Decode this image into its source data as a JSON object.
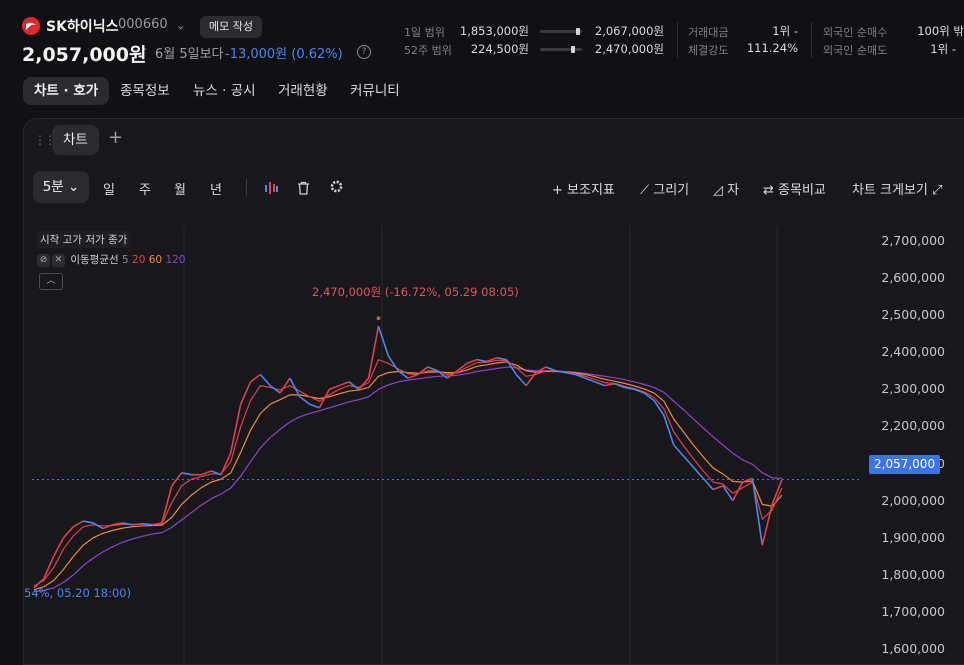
{
  "header": {
    "name": "SK하이닉스",
    "code": "000660",
    "memo_label": "메모 작성",
    "price": "2,057,000원",
    "since": "6월 5일보다",
    "change": "-13,000원 (0.62%)",
    "help": "?"
  },
  "ranges": {
    "day_label": "1일 범위",
    "day_low": "1,853,000원",
    "day_high": "2,067,000원",
    "day_position": 0.95,
    "week52_label": "52주 범위",
    "week52_low": "224,500원",
    "week52_high": "2,470,000원",
    "week52_position": 0.81
  },
  "stats": {
    "volume_rank_label": "거래대금",
    "volume_rank": "1위 -",
    "strength_label": "체결강도",
    "strength": "111.24%",
    "foreign_buy_label": "외국인 순매수",
    "foreign_buy": "100위 밖",
    "foreign_sell_label": "외국인 순매도",
    "foreign_sell": "1위 -"
  },
  "tabs": [
    "차트 · 호가",
    "종목정보",
    "뉴스 · 공시",
    "거래현황",
    "커뮤니티"
  ],
  "chart_panel": {
    "tab_label": "차트",
    "add": "+",
    "period": "5분",
    "ranges": [
      "일",
      "주",
      "월",
      "년"
    ],
    "tools": {
      "indicator": "보조지표",
      "draw": "그리기",
      "ruler": "자",
      "compare": "종목비교",
      "fullscreen": "차트 크게보기"
    },
    "legend": "시작 고가 저가 종가",
    "ma_label": "이동평균선",
    "ma_periods": [
      {
        "label": "5",
        "color": "#8a8a92"
      },
      {
        "label": "20",
        "color": "#e0404a"
      },
      {
        "label": "60",
        "color": "#f08a3a"
      },
      {
        "label": "120",
        "color": "#8e44c8"
      }
    ],
    "current_price_tag": "2,057,000",
    "high_annotation": "2,470,000원 (-16.72%, 05.29 08:05)",
    "low_annotation": "54%, 05.20 18:00)"
  },
  "chart_data": {
    "type": "line",
    "yticks": [
      "2,700,000",
      "2,600,000",
      "2,500,000",
      "2,400,000",
      "2,300,000",
      "2,200,000",
      "2,100,000",
      "2,000,000",
      "1,900,000",
      "1,800,000",
      "1,700,000",
      "1,600,000"
    ],
    "ylim": [
      1560000,
      2740000
    ],
    "current": 2057000,
    "high": 2470000,
    "colors": {
      "up": "#e0404a",
      "down": "#4a86f0",
      "ma20": "#e0404a",
      "ma60": "#f08a3a",
      "ma120": "#8e44c8"
    },
    "price_series": [
      1765000,
      1790000,
      1850000,
      1900000,
      1930000,
      1945000,
      1940000,
      1925000,
      1935000,
      1940000,
      1935000,
      1938000,
      1935000,
      1940000,
      2040000,
      2075000,
      2070000,
      2070000,
      2080000,
      2070000,
      2130000,
      2260000,
      2320000,
      2340000,
      2310000,
      2290000,
      2330000,
      2280000,
      2260000,
      2250000,
      2300000,
      2310000,
      2320000,
      2300000,
      2330000,
      2470000,
      2390000,
      2350000,
      2330000,
      2340000,
      2360000,
      2350000,
      2330000,
      2350000,
      2370000,
      2380000,
      2375000,
      2385000,
      2380000,
      2340000,
      2310000,
      2345000,
      2360000,
      2350000,
      2345000,
      2340000,
      2330000,
      2320000,
      2310000,
      2315000,
      2305000,
      2300000,
      2290000,
      2270000,
      2230000,
      2150000,
      2120000,
      2090000,
      2060000,
      2030000,
      2040000,
      2000000,
      2050000,
      2060000,
      1880000,
      1990000,
      2057000
    ],
    "ma20_series": [
      1770000,
      1785000,
      1820000,
      1870000,
      1905000,
      1930000,
      1935000,
      1932000,
      1933000,
      1936000,
      1936000,
      1937000,
      1936000,
      1937000,
      1995000,
      2040000,
      2058000,
      2065000,
      2072000,
      2072000,
      2105000,
      2200000,
      2270000,
      2310000,
      2305000,
      2298000,
      2310000,
      2295000,
      2280000,
      2268000,
      2285000,
      2300000,
      2310000,
      2305000,
      2318000,
      2380000,
      2370000,
      2355000,
      2342000,
      2340000,
      2350000,
      2350000,
      2340000,
      2345000,
      2360000,
      2372000,
      2373000,
      2378000,
      2378000,
      2358000,
      2335000,
      2340000,
      2350000,
      2350000,
      2347000,
      2342000,
      2335000,
      2327000,
      2318000,
      2316000,
      2308000,
      2302000,
      2293000,
      2278000,
      2248000,
      2185000,
      2148000,
      2113000,
      2080000,
      2050000,
      2045000,
      2020000,
      2035000,
      2050000,
      1950000,
      1975000,
      2035000
    ],
    "ma60_series": [
      1760000,
      1768000,
      1785000,
      1815000,
      1850000,
      1880000,
      1900000,
      1912000,
      1920000,
      1926000,
      1930000,
      1932000,
      1933000,
      1934000,
      1955000,
      1990000,
      2015000,
      2035000,
      2050000,
      2058000,
      2075000,
      2130000,
      2190000,
      2235000,
      2260000,
      2272000,
      2285000,
      2285000,
      2280000,
      2275000,
      2280000,
      2288000,
      2295000,
      2298000,
      2305000,
      2335000,
      2345000,
      2348000,
      2345000,
      2343000,
      2346000,
      2347000,
      2345000,
      2345000,
      2352000,
      2362000,
      2366000,
      2371000,
      2374000,
      2365000,
      2350000,
      2346000,
      2348000,
      2348000,
      2347000,
      2344000,
      2340000,
      2334000,
      2327000,
      2322000,
      2316000,
      2309000,
      2301000,
      2290000,
      2268000,
      2220000,
      2185000,
      2150000,
      2118000,
      2088000,
      2072000,
      2052000,
      2050000,
      2053000,
      1990000,
      1985000,
      2015000
    ],
    "ma120_series": [
      1755000,
      1758000,
      1765000,
      1780000,
      1800000,
      1825000,
      1845000,
      1862000,
      1876000,
      1888000,
      1897000,
      1904000,
      1910000,
      1914000,
      1928000,
      1948000,
      1968000,
      1988000,
      2005000,
      2018000,
      2034000,
      2066000,
      2105000,
      2142000,
      2170000,
      2192000,
      2212000,
      2226000,
      2235000,
      2242000,
      2250000,
      2258000,
      2266000,
      2272000,
      2280000,
      2300000,
      2312000,
      2320000,
      2325000,
      2328000,
      2332000,
      2335000,
      2336000,
      2338000,
      2342000,
      2348000,
      2352000,
      2356000,
      2360000,
      2358000,
      2352000,
      2350000,
      2350000,
      2349000,
      2348000,
      2346000,
      2343000,
      2339000,
      2335000,
      2331000,
      2326000,
      2320000,
      2313000,
      2305000,
      2292000,
      2268000,
      2245000,
      2220000,
      2196000,
      2172000,
      2150000,
      2128000,
      2110000,
      2098000,
      2075000,
      2062000,
      2060000
    ]
  }
}
